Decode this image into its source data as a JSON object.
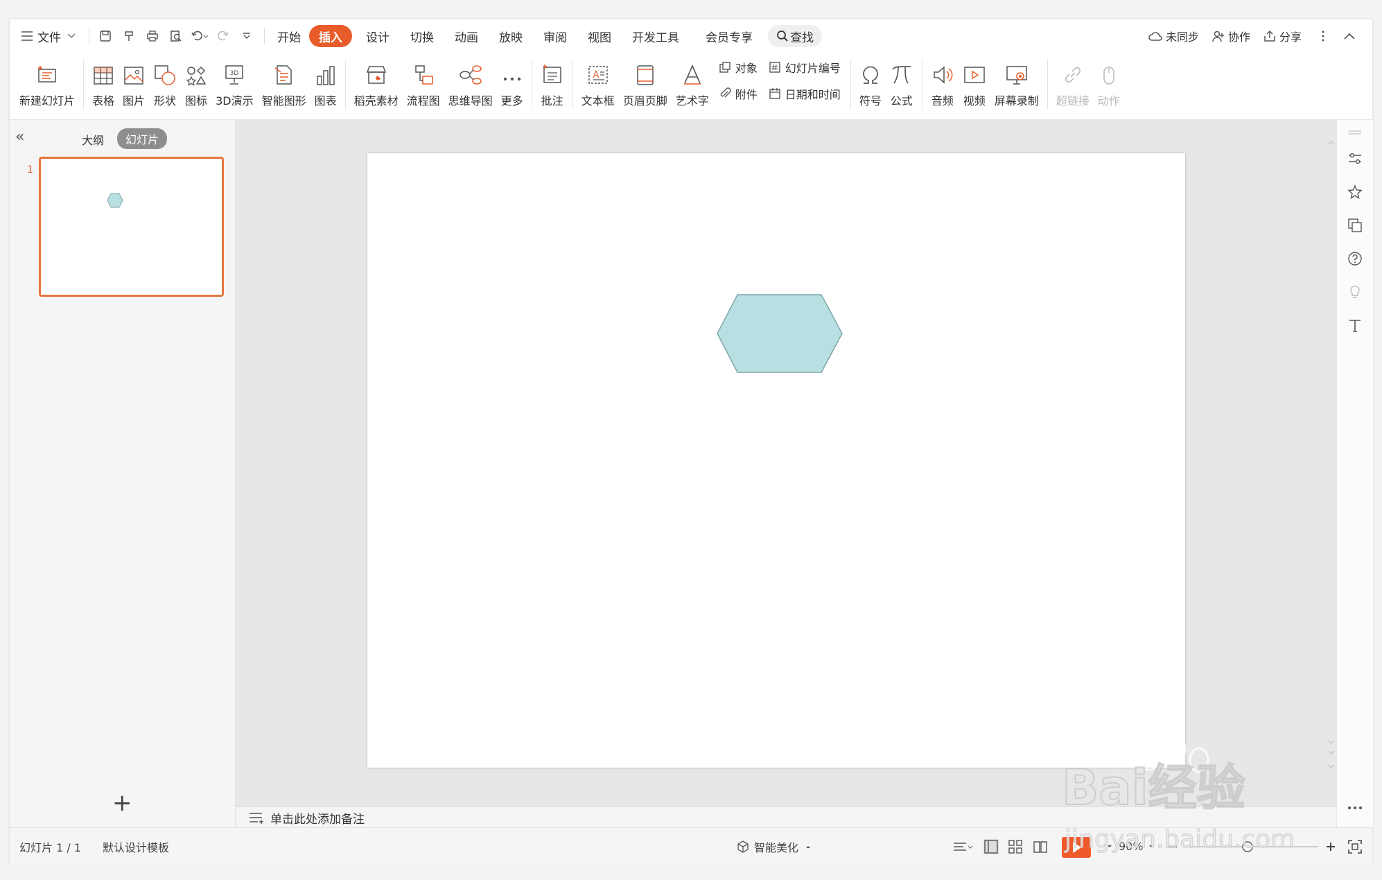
{
  "menu": {
    "file_label": "文件",
    "tabs": [
      "开始",
      "插入",
      "设计",
      "切换",
      "动画",
      "放映",
      "审阅",
      "视图",
      "开发工具",
      "会员专享"
    ],
    "active_tab": "插入",
    "search_label": "查找",
    "sync_label": "未同步",
    "collab_label": "协作",
    "share_label": "分享"
  },
  "ribbon": {
    "new_slide": "新建幻灯片",
    "table": "表格",
    "picture": "图片",
    "shape": "形状",
    "icon": "图标",
    "demo_3d": "3D演示",
    "smart_art": "智能图形",
    "chart": "图表",
    "material": "稻壳素材",
    "flowchart": "流程图",
    "mindmap": "思维导图",
    "more": "更多",
    "comment": "批注",
    "textbox": "文本框",
    "header_footer": "页眉页脚",
    "wordart": "艺术字",
    "object": "对象",
    "slide_number": "幻灯片编号",
    "attachment": "附件",
    "datetime": "日期和时间",
    "symbol": "符号",
    "formula": "公式",
    "audio": "音频",
    "video": "视频",
    "screen_record": "屏幕录制",
    "hyperlink": "超链接",
    "action": "动作"
  },
  "left_panel": {
    "outline_tab": "大纲",
    "slides_tab": "幻灯片",
    "slide_number": "1",
    "add_icon": "+"
  },
  "notes": {
    "placeholder": "单击此处添加备注"
  },
  "status": {
    "slide_count": "幻灯片 1 / 1",
    "template": "默认设计模板",
    "beautify": "智能美化",
    "zoom": "90%"
  },
  "colors": {
    "accent": "#e85c2b",
    "hexagon_fill": "#b8dfe2",
    "hexagon_stroke": "#7fa7aa"
  },
  "watermark": {
    "line1": "Bai经验",
    "line2": "jingyan.baidu.com"
  }
}
